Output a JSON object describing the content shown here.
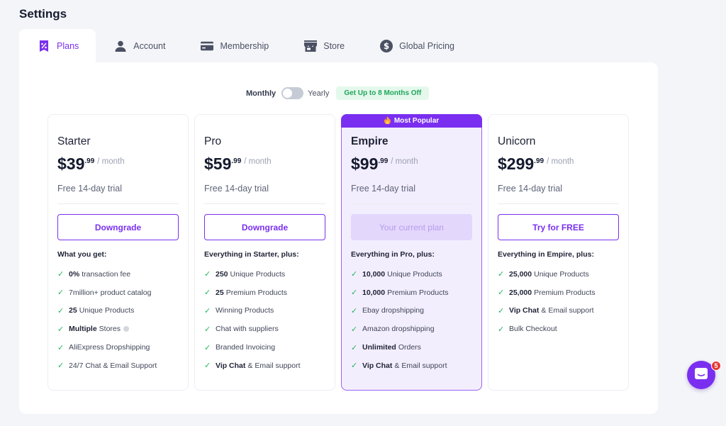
{
  "page": {
    "title": "Settings"
  },
  "tabs": [
    {
      "label": "Plans",
      "icon": "percent-tag-icon",
      "active": true
    },
    {
      "label": "Account",
      "icon": "user-icon",
      "active": false
    },
    {
      "label": "Membership",
      "icon": "credit-card-icon",
      "active": false
    },
    {
      "label": "Store",
      "icon": "storefront-icon",
      "active": false
    },
    {
      "label": "Global Pricing",
      "icon": "dollar-circle-icon",
      "active": false
    }
  ],
  "billing": {
    "monthly_label": "Monthly",
    "yearly_label": "Yearly",
    "yearly_selected": false,
    "promo": "Get Up to 8 Months Off"
  },
  "plans": [
    {
      "name": "Starter",
      "price": "$39",
      "cents": ".99",
      "period": "/ month",
      "trial": "Free 14-day trial",
      "cta": "Downgrade",
      "features_heading": "What you get:",
      "features": [
        {
          "bold": "0%",
          "text": "transaction fee"
        },
        {
          "bold": "",
          "text": "7million+ product catalog"
        },
        {
          "bold": "25",
          "text": "Unique Products"
        },
        {
          "bold": "Multiple",
          "text": "Stores"
        },
        {
          "bold": "",
          "text": "AliExpress Dropshipping"
        },
        {
          "bold": "",
          "text": "24/7 Chat & Email Support"
        }
      ]
    },
    {
      "name": "Pro",
      "price": "$59",
      "cents": ".99",
      "period": "/ month",
      "trial": "Free 14-day trial",
      "cta": "Downgrade",
      "features_heading": "Everything in Starter, plus:",
      "features": [
        {
          "bold": "250",
          "text": "Unique Products"
        },
        {
          "bold": "25",
          "text": "Premium Products"
        },
        {
          "bold": "",
          "text": "Winning Products"
        },
        {
          "bold": "",
          "text": "Chat with suppliers"
        },
        {
          "bold": "",
          "text": "Branded Invoicing"
        },
        {
          "bold": "Vip Chat",
          "text": "& Email support"
        }
      ]
    },
    {
      "name": "Empire",
      "price": "$99",
      "cents": ".99",
      "period": "/ month",
      "trial": "Free 14-day trial",
      "cta": "Your current plan",
      "badge": "Most Popular",
      "features_heading": "Everything in Pro, plus:",
      "features": [
        {
          "bold": "10,000",
          "text": "Unique Products"
        },
        {
          "bold": "10,000",
          "text": "Premium Products"
        },
        {
          "bold": "",
          "text": "Ebay dropshipping"
        },
        {
          "bold": "",
          "text": "Amazon dropshipping"
        },
        {
          "bold": "Unlimited",
          "text": "Orders"
        },
        {
          "bold": "Vip Chat",
          "text": "& Email support"
        }
      ]
    },
    {
      "name": "Unicorn",
      "price": "$299",
      "cents": ".99",
      "period": "/ month",
      "trial": "Free 14-day trial",
      "cta": "Try for FREE",
      "features_heading": "Everything in Empire, plus:",
      "features": [
        {
          "bold": "25,000",
          "text": "Unique Products"
        },
        {
          "bold": "25,000",
          "text": "Premium Products"
        },
        {
          "bold": "Vip Chat",
          "text": "& Email support"
        },
        {
          "bold": "",
          "text": "Bulk Checkout"
        }
      ]
    }
  ],
  "chat": {
    "icon": "chat-bubble-icon",
    "badge_count": "5"
  },
  "colors": {
    "accent": "#7a2ff0",
    "check": "#22b55c",
    "promo_bg": "#e5f8ec",
    "badge": "#e53935"
  }
}
